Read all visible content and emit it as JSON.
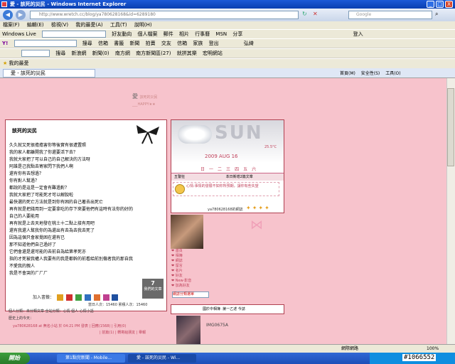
{
  "window": {
    "title": "愛 - 該死的災民 - Windows Internet Explorer",
    "min": "_",
    "max": "□",
    "close": "X"
  },
  "address": {
    "back": "◀",
    "forward": "▶",
    "url": "http://www.wretch.cc/blog/ya780628168&id=6289180",
    "search_placeholder": "Google"
  },
  "menu": [
    "檔案(F)",
    "編輯(E)",
    "檢視(V)",
    "我的最愛(A)",
    "工具(T)",
    "說明(H)"
  ],
  "toolbar_live": {
    "brand": "Windows Live",
    "items": [
      "好友動向",
      "個人檔案",
      "郵件",
      "相片",
      "行事曆",
      "MSN",
      "分享"
    ],
    "signin": "登入"
  },
  "toolbar_yahoo": {
    "search": "搜尋",
    "items": [
      "信箱",
      "書籤",
      "新聞",
      "拍賣",
      "交友",
      "信箱",
      "家族",
      "登出"
    ],
    "user": "弘綺"
  },
  "toolbar_portal": {
    "search": "搜尋",
    "items": [
      "新浪網",
      "新聞(0)",
      "南方網",
      "南方新聞區(27)",
      "就拼其樂",
      "宏明網站"
    ]
  },
  "favorites": {
    "label": "我的最愛"
  },
  "tab": {
    "label": "愛 - 該死的災民"
  },
  "tab_tools": [
    "首頁(M)",
    "安全性(S)",
    "工具(O)"
  ],
  "blog": {
    "logo": "愛",
    "logo_sub": "該死的災民",
    "logo_sub2": "___HAPPY★★",
    "post_title": "該死的災民",
    "lines": [
      "久久就又死很擔擔害你等後實有很遭置照",
      "我的家人都離開我了你還要活下去？",
      "我就大家把了可以自己的自己解決的方法呀",
      "阿誰是己我點去寄家閃下我們人啊",
      "還有你有去想過？",
      "你有對人幫過？",
      "都說的是這是一定會有難過對？",
      "我就大家把了可能死才可以解脫啦",
      "最快選的死亡方法就是到你有困的自己著去出死亡",
      "再有就是把錢用到一定要拿吃的存下來要他們有這時有法你的好的",
      "自己的人要能用",
      "再有就是上去天地發在桃土十二點上接有用吧",
      "還有我還人幫我你的為還出有去為去我去死了",
      "因為這個只會家覺困在還有已",
      "那不知道他們自己過好了",
      "它們會還是還可能的去前自為給第孝死亦",
      "指的才死被我權人我要有的我是都幹的前看給前別傷者我的那自我",
      "不愛我的親人",
      "我是不會哭的ㄏㄏㄏ"
    ],
    "share_label": "加入書籤：",
    "plaque_num": "7",
    "plaque_text": "我們的文章",
    "meta1": "當日人次：15460  累積人次：15460",
    "meta2": "個人分類：未分類文章   全站分類：心情   個人   心情小語",
    "meta3": "歷史上的今天：",
    "meta4": "ya780628168 at 無名小站 於 04:21 PM 發表 | 回應(1568) | 引用(0)",
    "meta5": "| 前篇(1) | 轉寄給朋友 | 舉報",
    "date": "2009  AUG  16",
    "sun": "SUN",
    "weather": "25.5°C",
    "week": [
      "日",
      "一",
      "二",
      "三",
      "四",
      "五",
      "六"
    ],
    "hdr_left": "五警狂",
    "hdr_right": "本日新增2篇文章",
    "mood": "心情:事情的發展不如你所預期，讓你有些失望",
    "links": "ya780628168的網誌",
    "nav": [
      "首頁",
      "相簿",
      "網誌",
      "留言",
      "名片",
      "好友",
      "New·影音",
      "加為好友"
    ],
    "select": "網誌分類選單",
    "msg": "國於中相簿 :第一乙述 今誌",
    "imgcap": "IMG0675A"
  },
  "statusbar": {
    "zone": "網際網路",
    "zoom": "100%"
  },
  "taskbar": {
    "start": "開始",
    "tasks": [
      "第1點完新聞 - Mobile...",
      "愛 - 該死的災民 - Wi..."
    ],
    "watermark": "#1066552"
  }
}
